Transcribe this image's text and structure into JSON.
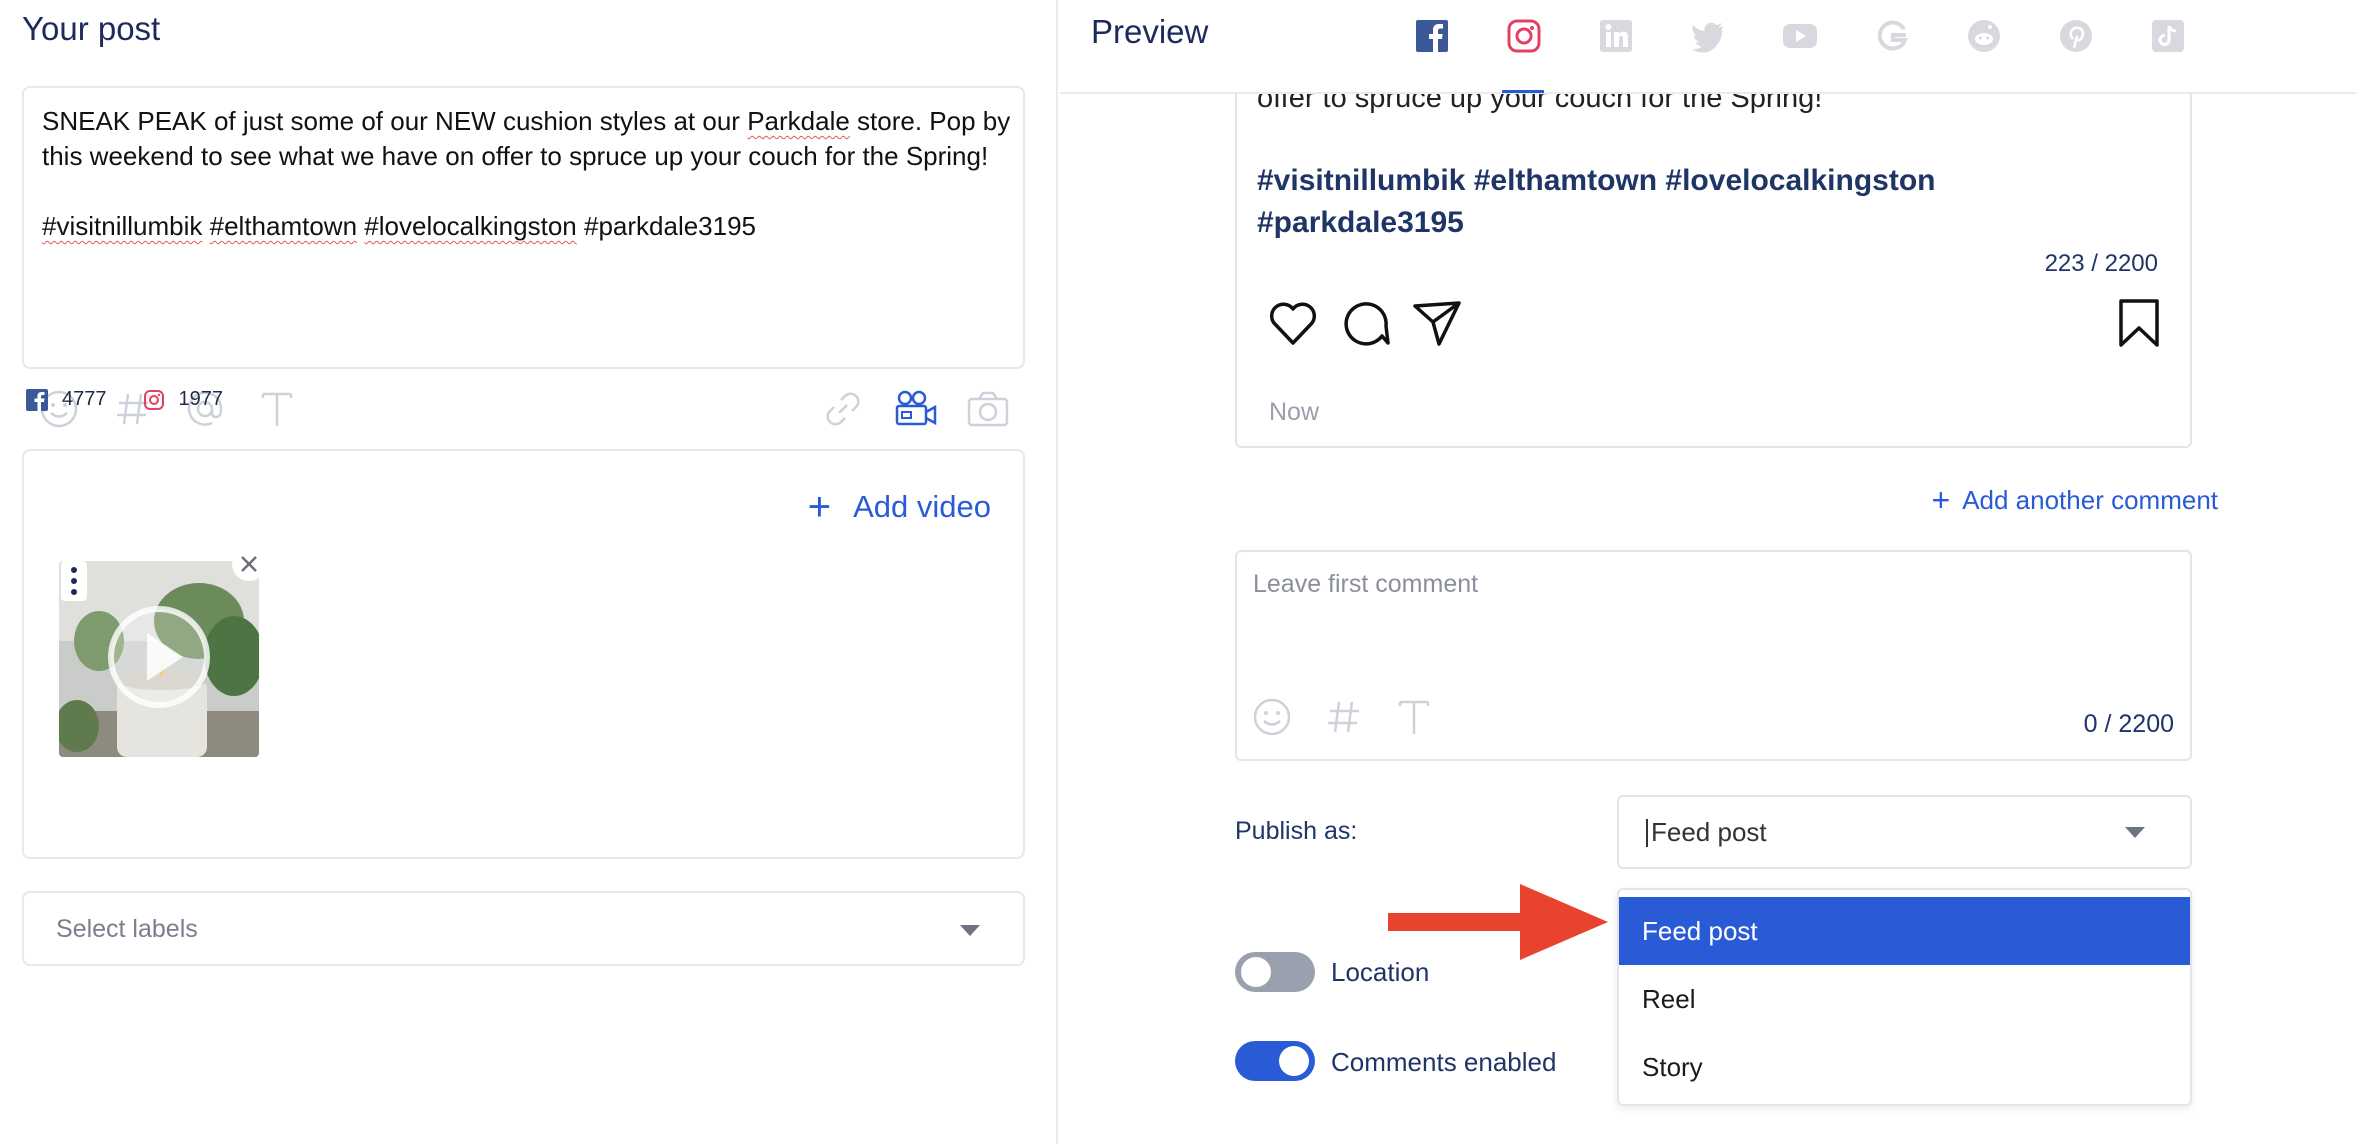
{
  "left": {
    "title": "Your post",
    "post_text": {
      "line1_a": "SNEAK PEAK of just some of our NEW cushion styles at our ",
      "line1_spell": "Parkdale",
      "line1_b": " store. Pop by this weekend to see what we have on offer to spruce up your couch for the Spring!",
      "tags": [
        "#visitnillumbik",
        "#elthamtown",
        "#lovelocalkingston",
        "#parkdale3195"
      ]
    },
    "toolbar_icons": [
      "emoji-icon",
      "hashtag-icon",
      "mention-icon",
      "text-format-icon",
      "link-icon",
      "video-camera-icon",
      "camera-icon"
    ],
    "counts": {
      "facebook": "4777",
      "instagram": "1977"
    },
    "add_video_label": "Add video",
    "labels_placeholder": "Select labels"
  },
  "right": {
    "title": "Preview",
    "networks": [
      "facebook",
      "instagram",
      "linkedin",
      "twitter",
      "youtube",
      "google",
      "reddit",
      "pinterest",
      "tiktok"
    ],
    "active_network": "instagram",
    "preview_text_tail": "offer to spruce up your couch for the Spring!",
    "preview_hashtags": "#visitnillumbik #elthamtown #lovelocalkingston #parkdale3195",
    "char_count": "223 / 2200",
    "timestamp": "Now",
    "add_comment_label": "Add another comment",
    "comment_placeholder": "Leave first comment",
    "comment_count": "0 / 2200",
    "publish_label": "Publish as:",
    "publish_value": "Feed post",
    "publish_options": [
      "Feed post",
      "Reel",
      "Story"
    ],
    "location_label": "Location",
    "location_enabled": false,
    "comments_label": "Comments enabled",
    "comments_enabled": true
  },
  "colors": {
    "accent": "#2a5bd7",
    "arrow": "#e8432d",
    "toggle_off": "#9aa0ae",
    "facebook": "#3b5998",
    "instagram": "#e4405f"
  }
}
